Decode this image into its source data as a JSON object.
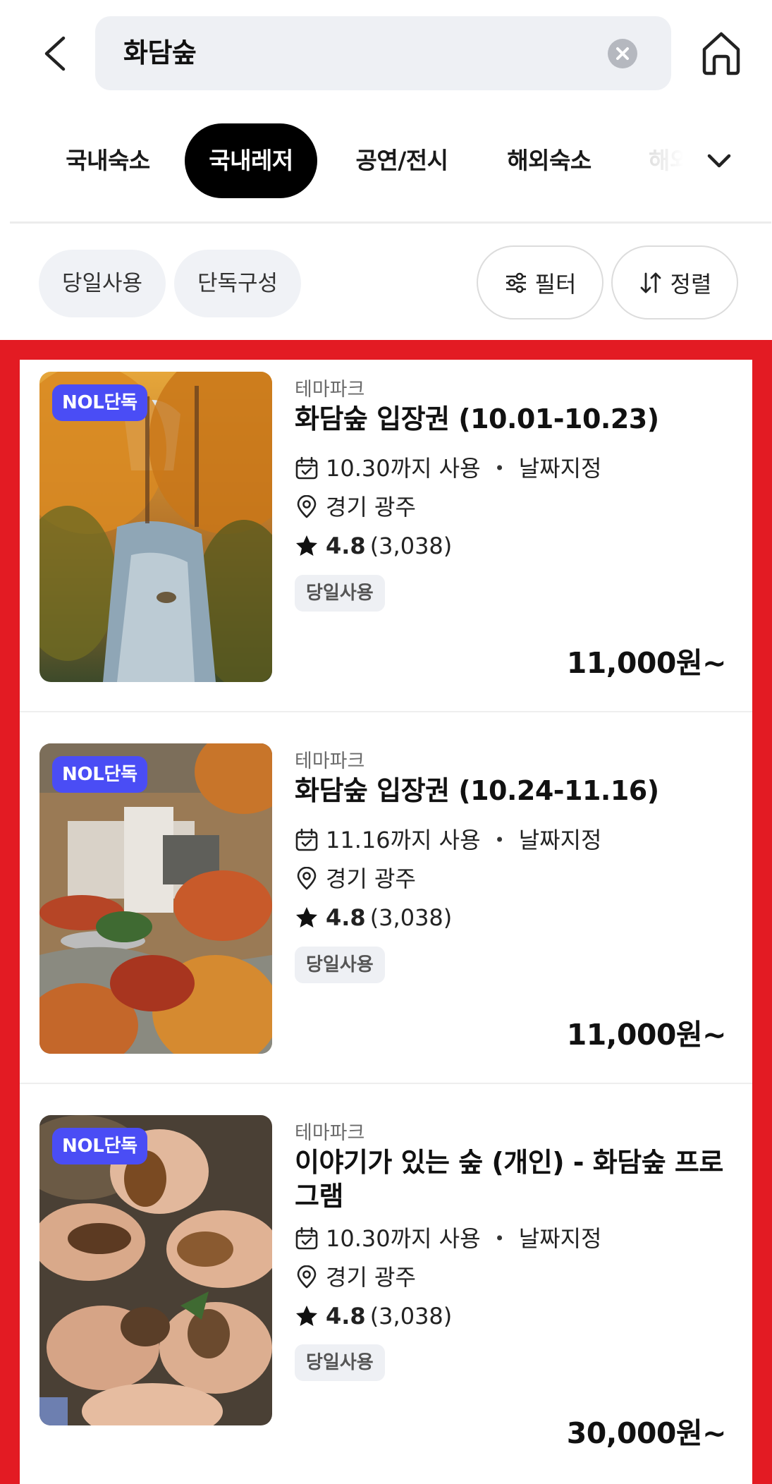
{
  "header": {
    "search_query": "화담숲"
  },
  "tabs": [
    {
      "label": "국내숙소",
      "active": false
    },
    {
      "label": "국내레저",
      "active": true
    },
    {
      "label": "공연/전시",
      "active": false
    },
    {
      "label": "해외숙소",
      "active": false
    },
    {
      "label": "해외",
      "active": false
    }
  ],
  "chips": [
    "당일사용",
    "단독구성"
  ],
  "filter_label": "필터",
  "sort_label": "정렬",
  "colors": {
    "accent": "#000000",
    "badge": "#4a4df5",
    "highlight_frame": "#e31b23"
  },
  "products": [
    {
      "badge": "NOL단독",
      "category": "테마파크",
      "title": "화담숲 입장권 (10.01-10.23)",
      "usage": "10.30까지 사용",
      "date_option": "날짜지정",
      "location": "경기 광주",
      "rating": "4.8",
      "review_count": "(3,038)",
      "tag": "당일사용",
      "price": "11,000원~"
    },
    {
      "badge": "NOL단독",
      "category": "테마파크",
      "title": "화담숲 입장권 (10.24-11.16)",
      "usage": "11.16까지 사용",
      "date_option": "날짜지정",
      "location": "경기 광주",
      "rating": "4.8",
      "review_count": "(3,038)",
      "tag": "당일사용",
      "price": "11,000원~"
    },
    {
      "badge": "NOL단독",
      "category": "테마파크",
      "title": "이야기가 있는 숲 (개인) - 화담숲 프로그램",
      "usage": "10.30까지 사용",
      "date_option": "날짜지정",
      "location": "경기 광주",
      "rating": "4.8",
      "review_count": "(3,038)",
      "tag": "당일사용",
      "price": "30,000원~"
    }
  ]
}
